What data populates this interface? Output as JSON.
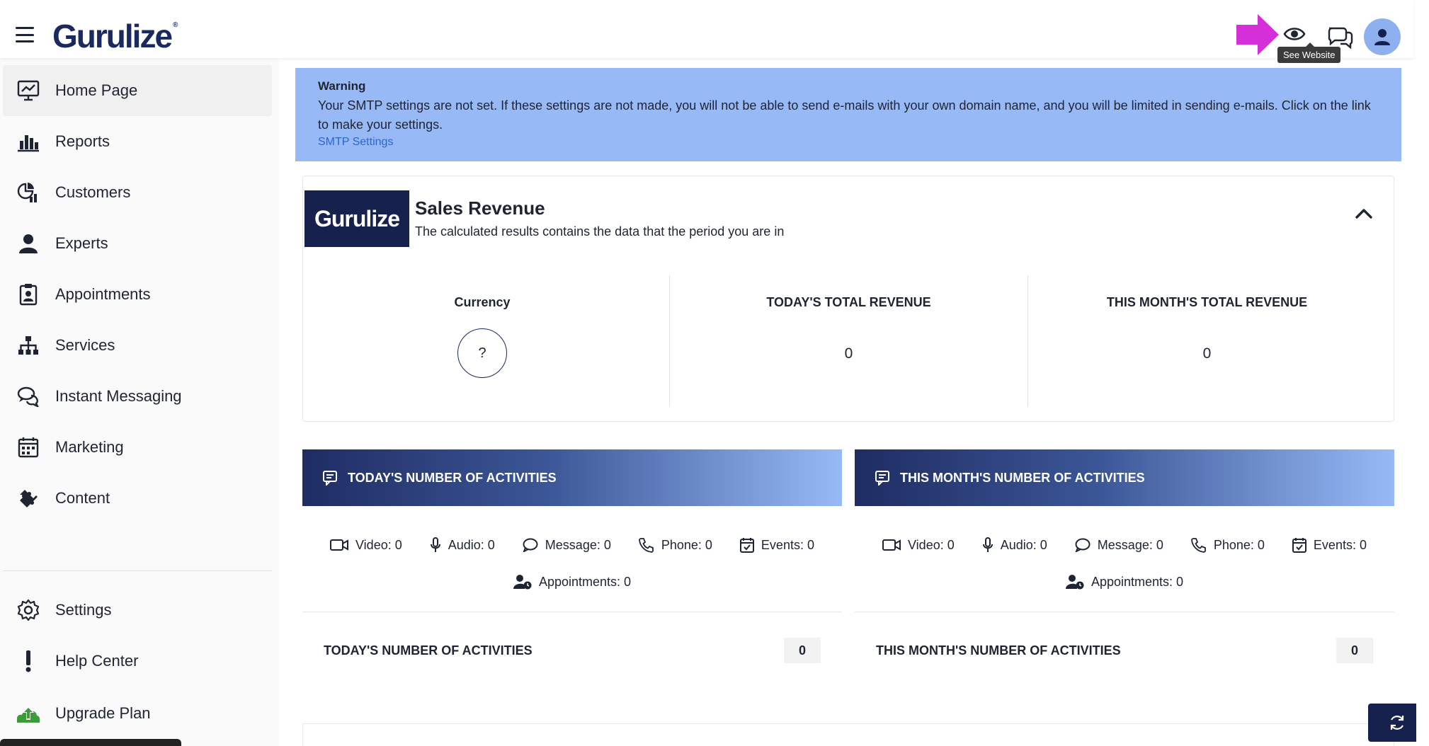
{
  "header": {
    "logo": "Gurulize",
    "tooltip": "See Website"
  },
  "sidebar": {
    "items": [
      {
        "label": "Home Page",
        "icon": "monitor-chart-icon"
      },
      {
        "label": "Reports",
        "icon": "bar-chart-icon"
      },
      {
        "label": "Customers",
        "icon": "pie-chart-icon"
      },
      {
        "label": "Experts",
        "icon": "user-icon"
      },
      {
        "label": "Appointments",
        "icon": "clipboard-user-icon"
      },
      {
        "label": "Services",
        "icon": "sitemap-icon"
      },
      {
        "label": "Instant Messaging",
        "icon": "chat-bubbles-icon"
      },
      {
        "label": "Marketing",
        "icon": "calendar-grid-icon"
      },
      {
        "label": "Content",
        "icon": "puzzle-icon"
      }
    ],
    "bottom_items": [
      {
        "label": "Settings",
        "icon": "gear-icon"
      },
      {
        "label": "Help Center",
        "icon": "exclamation-icon"
      },
      {
        "label": "Upgrade Plan",
        "icon": "upload-cloud-icon"
      }
    ]
  },
  "warning": {
    "title": "Warning",
    "message": "Your SMTP settings are not set. If these settings are not made, you will not be able to send e-mails with your own domain name, and you will be limited in sending e-mails. Click on the link to make your settings.",
    "link": "SMTP Settings"
  },
  "revenue": {
    "logo": "Gurulize",
    "title": "Sales Revenue",
    "subtitle": "The calculated results contains the data that the period you are in",
    "currency_label": "Currency",
    "currency_symbol": "?",
    "today_label": "TODAY'S TOTAL REVENUE",
    "today_value": "0",
    "month_label": "THIS MONTH'S TOTAL REVENUE",
    "month_value": "0"
  },
  "activities": {
    "today": {
      "title": "TODAY'S NUMBER OF ACTIVITIES",
      "video": "Video: 0",
      "audio": "Audio: 0",
      "message": "Message: 0",
      "phone": "Phone: 0",
      "events": "Events: 0",
      "appointments": "Appointments: 0",
      "footer_label": "TODAY'S NUMBER OF ACTIVITIES",
      "footer_value": "0"
    },
    "month": {
      "title": "THIS MONTH'S NUMBER OF ACTIVITIES",
      "video": "Video: 0",
      "audio": "Audio: 0",
      "message": "Message: 0",
      "phone": "Phone: 0",
      "events": "Events: 0",
      "appointments": "Appointments: 0",
      "footer_label": "THIS MONTH'S NUMBER OF ACTIVITIES",
      "footer_value": "0"
    }
  },
  "colors": {
    "brand_navy": "#16214d",
    "warning_bg": "#97baf7",
    "arrow": "#d42fd8",
    "avatar_bg": "#8fb0ef",
    "link": "#2c64d6"
  }
}
